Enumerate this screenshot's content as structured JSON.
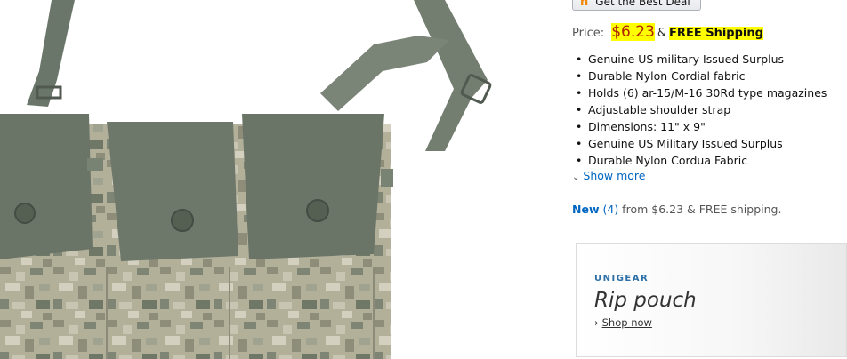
{
  "deal_button": {
    "label": "Get the Best Deal",
    "icon": "honey-h-icon"
  },
  "price": {
    "label": "Price:",
    "amount": "$6.23",
    "amp": "&",
    "shipping": "FREE Shipping"
  },
  "bullets": [
    "Genuine US military Issued Surplus",
    "Durable Nylon Cordial fabric",
    "Holds (6) ar-15/M-16 30Rd type magazines",
    "Adjustable shoulder strap",
    "Dimensions: 11\" x 9\"",
    "Genuine US Military Issued Surplus",
    "Durable Nylon Cordua Fabric"
  ],
  "show_more": "Show more",
  "offers": {
    "new_label": "New",
    "count": "(4)",
    "rest": " from $6.23 & FREE shipping."
  },
  "ad": {
    "brand": "UNIGEAR",
    "title": "Rip pouch",
    "shop": "Shop now"
  },
  "colors": {
    "link": "#0066c0",
    "price": "#b12704",
    "highlight": "#ffff00",
    "camo_base": "#a9a68e",
    "strap": "#6f7a6a"
  }
}
